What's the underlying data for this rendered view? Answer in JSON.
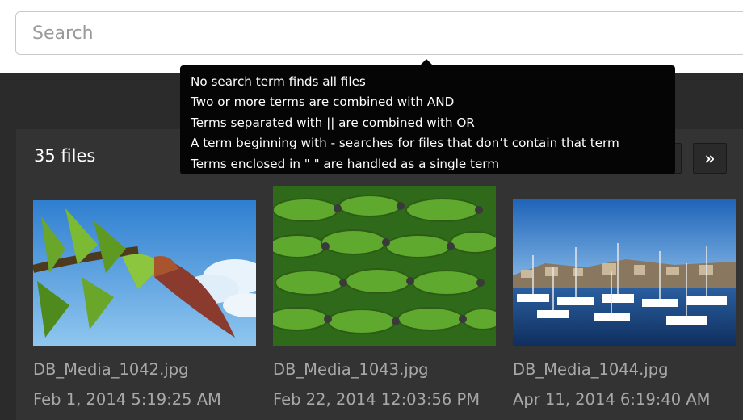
{
  "search": {
    "placeholder": "Search",
    "value": ""
  },
  "tooltip": {
    "lines": [
      "No search term finds all files",
      "Two or more terms are combined with AND",
      "Terms separated with || are combined with OR",
      "A term beginning with - searches for files that don’t contain that term",
      "Terms enclosed in \"  \" are handled as a single term"
    ]
  },
  "files": {
    "count_label": "35 files",
    "items": [
      {
        "name": "DB_Media_1042.jpg",
        "date": "Feb 1, 2014 5:19:25 AM"
      },
      {
        "name": "DB_Media_1043.jpg",
        "date": "Feb 22, 2014 12:03:56 PM"
      },
      {
        "name": "DB_Media_1044.jpg",
        "date": "Apr 11, 2014 6:19:40 AM"
      }
    ]
  },
  "pager": {
    "next_icon": "double-chevron-right-icon",
    "next_glyph": "»"
  }
}
